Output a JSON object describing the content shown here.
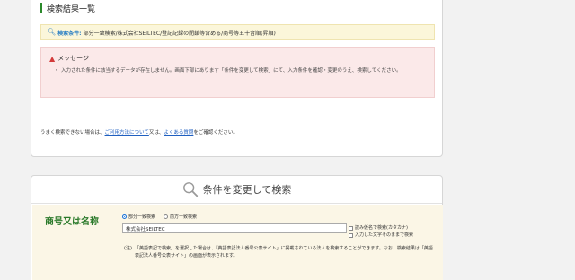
{
  "results": {
    "title": "検索結果一覧",
    "condition_label": "検索条件:",
    "condition_text": "部分一致検索/株式会社SEILTEC/登記記録の閉鎖等含める/商号等五十音順(昇順)",
    "message_title": "メッセージ",
    "message_body": "入力された条件に該当するデータが存在しません。画面下部にあります「条件を変更して検索」にて、入力条件を確認・変更のうえ、検索してください。",
    "help_prefix": "うまく検索できない場合は、",
    "help_link1": "ご利用方法について",
    "help_mid": "又は、",
    "help_link2": "よくある質問",
    "help_suffix": "をご確認ください。"
  },
  "search": {
    "heading": "条件を変更して検索",
    "field_label": "商号又は名称",
    "radio_partial": "部分一致検索",
    "radio_prefix": "前方一致検索",
    "name_value": "株式会社SEILTEC",
    "check_kana": "読み仮名で検索(カタカナ)",
    "check_exact": "入力した文字そのままで検索",
    "note_mark": "(注)",
    "note_text": "「英語表記で検索」を選択した場合は、「英語表記法人番号公表サイト」に掲載されている法人を検索することができます。なお、検索結果は「英語表記法人番号公表サイト」の画面が表示されます。"
  },
  "colors": {
    "accent_green": "#2b7a2b",
    "link_blue": "#1f5fc0",
    "condition_bg": "#fbf6da",
    "message_bg": "#fbe9e9",
    "warning_red": "#d33a3a"
  },
  "icons": {
    "condition": "search-icon",
    "message": "warning-icon",
    "search_head": "search-icon"
  }
}
